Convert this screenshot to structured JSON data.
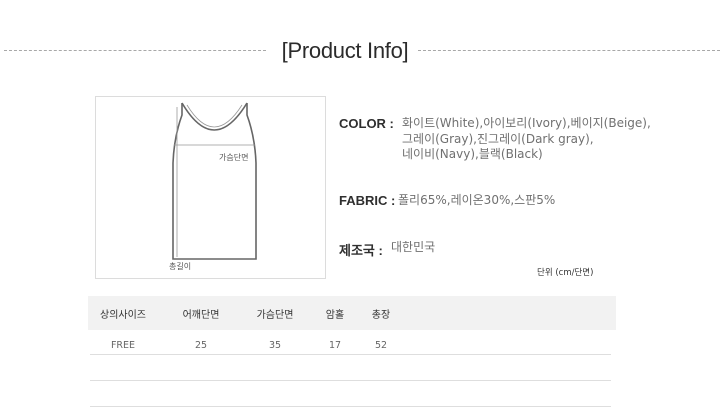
{
  "title": "[Product Info]",
  "diagram": {
    "chest_label": "가슴단면",
    "length_label": "총길이"
  },
  "specs": {
    "color": {
      "key": "COLOR :",
      "lines": [
        "화이트(White),아이보리(Ivory),베이지(Beige),",
        "그레이(Gray),진그레이(Dark gray),",
        "네이비(Navy),블랙(Black)"
      ]
    },
    "fabric": {
      "key": "FABRIC :",
      "value": "폴리65%,레이온30%,스판5%"
    },
    "origin": {
      "key": "제조국 :",
      "value": "대한민국"
    }
  },
  "unit_note": "단위 (cm/단면)",
  "size_table": {
    "headers": [
      "상의사이즈",
      "어깨단면",
      "가슴단면",
      "암홀",
      "총장"
    ],
    "rows": [
      [
        "FREE",
        "25",
        "35",
        "17",
        "52"
      ]
    ]
  }
}
